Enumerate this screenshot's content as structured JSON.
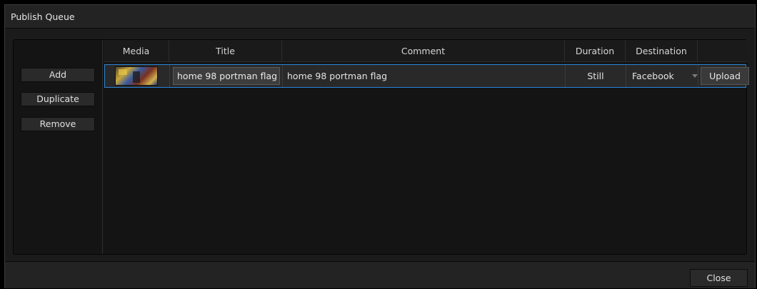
{
  "window": {
    "title": "Publish Queue"
  },
  "sidebar": {
    "add_label": "Add",
    "duplicate_label": "Duplicate",
    "remove_label": "Remove"
  },
  "table": {
    "columns": [
      "Media",
      "Title",
      "Comment",
      "Duration",
      "Destination",
      ""
    ],
    "rows": [
      {
        "media": "thumbnail",
        "title": "home 98 portman flag",
        "comment": "home 98 portman flag",
        "duration": "Still",
        "destination": "Facebook",
        "action": "Upload"
      }
    ]
  },
  "footer": {
    "close_label": "Close"
  },
  "colors": {
    "background": "#1b1b1b",
    "panel": "#141414",
    "selection_border": "#2a86d8",
    "text": "#d8d8d8"
  },
  "icons": {
    "dropdown": "chevron-down-icon"
  }
}
